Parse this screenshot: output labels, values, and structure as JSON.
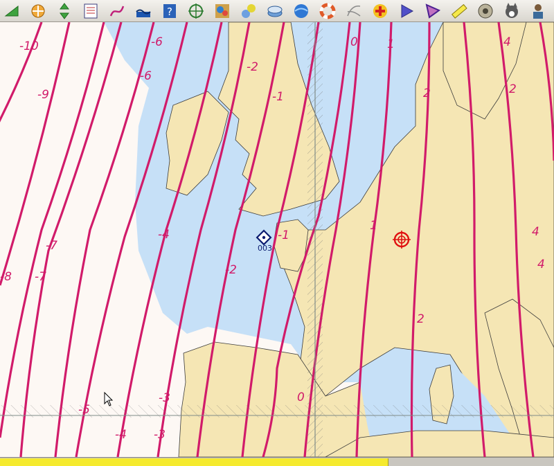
{
  "toolbar": {
    "tools": [
      {
        "icon": "triangle-arrow-icon"
      },
      {
        "icon": "zoom-arrows-icon"
      },
      {
        "icon": "vertical-arrows-icon"
      },
      {
        "icon": "route-list-icon"
      },
      {
        "icon": "track-icon"
      },
      {
        "icon": "tide-icon"
      },
      {
        "icon": "help-icon"
      },
      {
        "icon": "crosshair-icon"
      },
      {
        "icon": "weather-icon"
      },
      {
        "icon": "ais-icon"
      },
      {
        "icon": "layers-icon"
      },
      {
        "icon": "globe-icon"
      },
      {
        "icon": "lifebuoy-icon"
      },
      {
        "icon": "grib-icon"
      },
      {
        "icon": "plus-red-icon"
      },
      {
        "icon": "play-route-icon"
      },
      {
        "icon": "polygon-icon"
      },
      {
        "icon": "ruler-icon"
      },
      {
        "icon": "compass-icon"
      },
      {
        "icon": "dog-icon"
      },
      {
        "icon": "person-icon"
      }
    ]
  },
  "chart": {
    "colors": {
      "sea": "#c6e0f7",
      "land": "#f5e6b4",
      "unsurveyed": "#fdf8f4",
      "isogonic_line": "#d11b6a",
      "meridian": "#808c88"
    },
    "isogonic_labels": [
      "-10",
      "-9",
      "-8",
      "-7",
      "-7",
      "-6",
      "-6",
      "-5",
      "-4",
      "-4",
      "-3",
      "-3",
      "-2",
      "-2",
      "-1",
      "-1",
      "0",
      "0",
      "1",
      "1",
      "2",
      "2",
      "2",
      "4",
      "4",
      "4"
    ],
    "waypoint_label": "003",
    "status_progress_percent": 70
  }
}
